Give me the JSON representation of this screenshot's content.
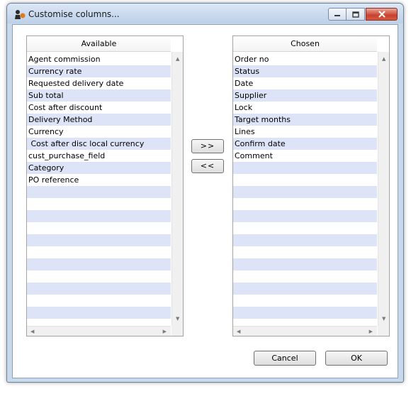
{
  "window": {
    "title": "Customise columns..."
  },
  "available": {
    "header": "Available",
    "items": [
      "Agent commission",
      "Currency rate",
      "Requested delivery date",
      "Sub total",
      "Cost after discount",
      "Delivery Method",
      "Currency",
      " Cost after disc local currency",
      "cust_purchase_field",
      "Category",
      "PO reference"
    ]
  },
  "chosen": {
    "header": "Chosen",
    "items": [
      "Order no",
      "Status",
      "Date",
      "Supplier",
      "Lock",
      "Target months",
      "Lines",
      "Confirm date",
      "Comment"
    ]
  },
  "buttons": {
    "add": ">>",
    "remove": "<<",
    "cancel": "Cancel",
    "ok": "OK"
  },
  "colors": {
    "row_alt": "#dde4f7",
    "window_frame": "#c8d9ec",
    "close_button": "#c9412f"
  }
}
